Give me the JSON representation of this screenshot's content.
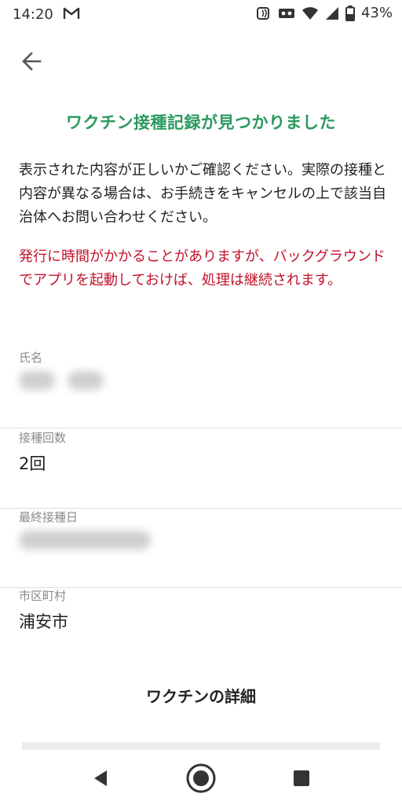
{
  "status_bar": {
    "time": "14:20",
    "battery": "43%",
    "icons": [
      "gmail-icon",
      "nfc-icon",
      "voicemail-icon",
      "wifi-icon",
      "signal-icon",
      "battery-icon"
    ]
  },
  "header": {
    "back_icon": "back-arrow-icon",
    "title": "ワクチン接種記録が見つかりました"
  },
  "messages": {
    "confirm": "表示された内容が正しいかご確認ください。実際の接種と内容が異なる場合は、お手続きをキャンセルの上で該当自治体へお問い合わせください。",
    "warning": "発行に時間がかかることがありますが、バックグラウンドでアプリを起動しておけば、処理は継続されます。"
  },
  "fields": {
    "name": {
      "label": "氏名"
    },
    "dose_count": {
      "label": "接種回数",
      "value": "2回"
    },
    "last_date": {
      "label": "最終接種日"
    },
    "municipality": {
      "label": "市区町村",
      "value": "浦安市"
    }
  },
  "actions": {
    "details_label": "ワクチンの詳細"
  },
  "colors": {
    "title_green": "#2b9a5f",
    "warning_red": "#c1122a",
    "label_gray": "#8a8a8a"
  },
  "nav": {
    "icons": [
      "nav-back-icon",
      "nav-home-icon",
      "nav-recents-icon"
    ]
  }
}
